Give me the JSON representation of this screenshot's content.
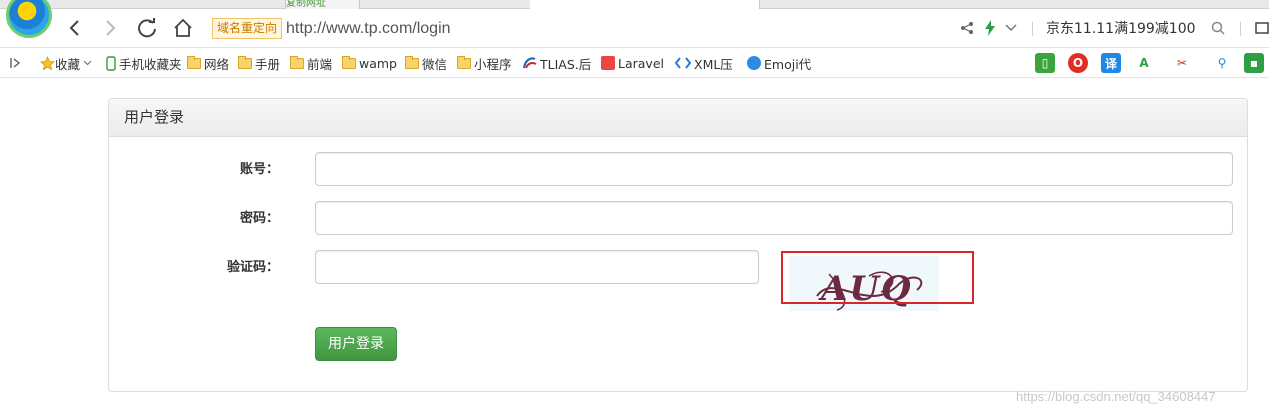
{
  "browser": {
    "copy_tab_label": "复制网址",
    "redirect_badge": "域名重定向",
    "url": "http://www.tp.com/login",
    "promo_text": "京东11.11满199减100"
  },
  "bookmarks": [
    {
      "label": "收藏",
      "icon": "star-icon"
    },
    {
      "label": "手机收藏夹",
      "icon": "phone-icon"
    },
    {
      "label": "网络",
      "icon": "folder-icon"
    },
    {
      "label": "手册",
      "icon": "folder-icon"
    },
    {
      "label": "前端",
      "icon": "folder-icon"
    },
    {
      "label": "wamp",
      "icon": "folder-icon"
    },
    {
      "label": "微信",
      "icon": "folder-icon"
    },
    {
      "label": "小程序",
      "icon": "folder-icon"
    },
    {
      "label": "TLIAS.后",
      "icon": "tlias-icon"
    },
    {
      "label": "Laravel",
      "icon": "laravel-icon"
    },
    {
      "label": "XML压",
      "icon": "xml-icon"
    },
    {
      "label": "Emoji代",
      "icon": "info-icon"
    }
  ],
  "toolbar": {
    "translate_label": "译"
  },
  "login": {
    "title": "用户登录",
    "account_label": "账号：",
    "password_label": "密码：",
    "captcha_label": "验证码：",
    "account_value": "",
    "password_value": "",
    "captcha_value": "",
    "captcha_text": "AUQ",
    "submit_label": "用户登录"
  },
  "watermark": "https://blog.csdn.net/qq_34608447",
  "colors": {
    "accent_green": "#5cb85c",
    "captcha_border": "#d9262b",
    "captcha_ink": "#6b2a3f"
  }
}
